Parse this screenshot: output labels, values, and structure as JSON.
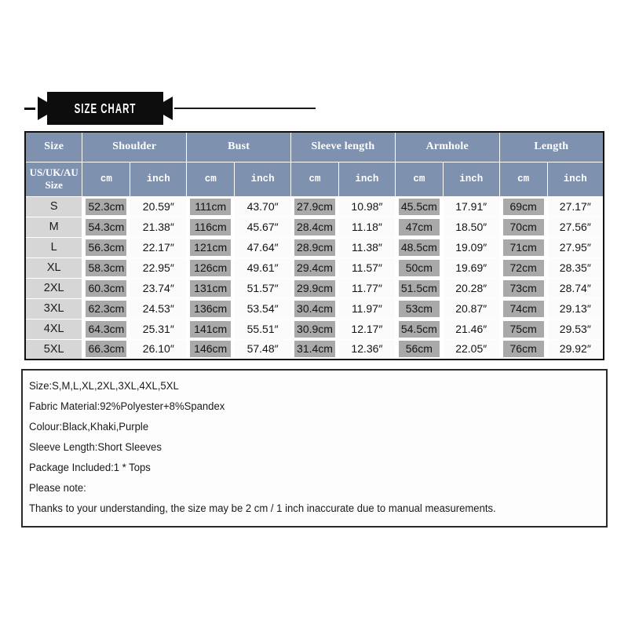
{
  "banner": {
    "title": "SIZE CHART"
  },
  "table": {
    "size_header": "Size",
    "size_subheader_line1": "US/UK/AU",
    "size_subheader_line2": "Size",
    "groups": [
      "Shoulder",
      "Bust",
      "Sleeve length",
      "Armhole",
      "Length"
    ],
    "sub_units": [
      "cm",
      "inch"
    ],
    "rows": [
      {
        "size": "S",
        "shoulder_cm": "52.3cm",
        "shoulder_in": "20.59″",
        "bust_cm": "111cm",
        "bust_in": "43.70″",
        "sleeve_cm": "27.9cm",
        "sleeve_in": "10.98″",
        "armhole_cm": "45.5cm",
        "armhole_in": "17.91″",
        "length_cm": "69cm",
        "length_in": "27.17″"
      },
      {
        "size": "M",
        "shoulder_cm": "54.3cm",
        "shoulder_in": "21.38″",
        "bust_cm": "116cm",
        "bust_in": "45.67″",
        "sleeve_cm": "28.4cm",
        "sleeve_in": "11.18″",
        "armhole_cm": "47cm",
        "armhole_in": "18.50″",
        "length_cm": "70cm",
        "length_in": "27.56″"
      },
      {
        "size": "L",
        "shoulder_cm": "56.3cm",
        "shoulder_in": "22.17″",
        "bust_cm": "121cm",
        "bust_in": "47.64″",
        "sleeve_cm": "28.9cm",
        "sleeve_in": "11.38″",
        "armhole_cm": "48.5cm",
        "armhole_in": "19.09″",
        "length_cm": "71cm",
        "length_in": "27.95″"
      },
      {
        "size": "XL",
        "shoulder_cm": "58.3cm",
        "shoulder_in": "22.95″",
        "bust_cm": "126cm",
        "bust_in": "49.61″",
        "sleeve_cm": "29.4cm",
        "sleeve_in": "11.57″",
        "armhole_cm": "50cm",
        "armhole_in": "19.69″",
        "length_cm": "72cm",
        "length_in": "28.35″"
      },
      {
        "size": "2XL",
        "shoulder_cm": "60.3cm",
        "shoulder_in": "23.74″",
        "bust_cm": "131cm",
        "bust_in": "51.57″",
        "sleeve_cm": "29.9cm",
        "sleeve_in": "11.77″",
        "armhole_cm": "51.5cm",
        "armhole_in": "20.28″",
        "length_cm": "73cm",
        "length_in": "28.74″"
      },
      {
        "size": "3XL",
        "shoulder_cm": "62.3cm",
        "shoulder_in": "24.53″",
        "bust_cm": "136cm",
        "bust_in": "53.54″",
        "sleeve_cm": "30.4cm",
        "sleeve_in": "11.97″",
        "armhole_cm": "53cm",
        "armhole_in": "20.87″",
        "length_cm": "74cm",
        "length_in": "29.13″"
      },
      {
        "size": "4XL",
        "shoulder_cm": "64.3cm",
        "shoulder_in": "25.31″",
        "bust_cm": "141cm",
        "bust_in": "55.51″",
        "sleeve_cm": "30.9cm",
        "sleeve_in": "12.17″",
        "armhole_cm": "54.5cm",
        "armhole_in": "21.46″",
        "length_cm": "75cm",
        "length_in": "29.53″"
      },
      {
        "size": "5XL",
        "shoulder_cm": "66.3cm",
        "shoulder_in": "26.10″",
        "bust_cm": "146cm",
        "bust_in": "57.48″",
        "sleeve_cm": "31.4cm",
        "sleeve_in": "12.36″",
        "armhole_cm": "56cm",
        "armhole_in": "22.05″",
        "length_cm": "76cm",
        "length_in": "29.92″"
      }
    ]
  },
  "notes": {
    "lines": [
      "Size:S,M,L,XL,2XL,3XL,4XL,5XL",
      "Fabric Material:92%Polyester+8%Spandex",
      "Colour:Black,Khaki,Purple",
      "Sleeve Length:Short Sleeves",
      "Package Included:1 * Tops",
      "Please note:",
      "Thanks to your understanding, the size may be 2 cm / 1 inch inaccurate due to manual measurements."
    ]
  },
  "colors": {
    "header_blue": "#7e91ae",
    "cell_gray": "#a9a9a9",
    "size_col_gray": "#d6d6d6",
    "banner_black": "#0d0d0d",
    "border_black": "#111111"
  }
}
